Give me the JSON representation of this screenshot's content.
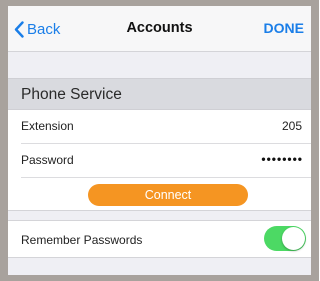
{
  "navbar": {
    "back_label": "Back",
    "title": "Accounts",
    "done_label": "DONE"
  },
  "section": {
    "title": "Phone Service"
  },
  "fields": {
    "extension": {
      "label": "Extension",
      "value": "205"
    },
    "password": {
      "label": "Password",
      "value": "••••••••"
    }
  },
  "connect": {
    "label": "Connect"
  },
  "remember": {
    "label": "Remember Passwords",
    "enabled": true
  },
  "colors": {
    "accent_blue": "#1a7ee8",
    "connect_orange": "#f59522",
    "toggle_green": "#4cd964",
    "frame_gray": "#a8a29d"
  }
}
